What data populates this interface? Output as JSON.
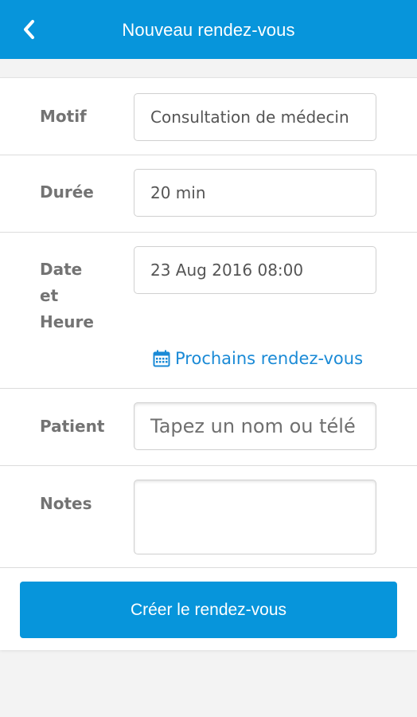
{
  "header": {
    "title": "Nouveau rendez-vous",
    "back_icon": "chevron-left-icon"
  },
  "form": {
    "motif": {
      "label": "Motif",
      "value": "Consultation de médecin"
    },
    "duree": {
      "label": "Durée",
      "value": "20 min"
    },
    "datetime": {
      "label_lines": [
        "Date",
        "et",
        "Heure"
      ],
      "value": "23 Aug 2016 08:00",
      "link_label": "Prochains rendez-vous",
      "link_icon": "calendar-icon"
    },
    "patient": {
      "label": "Patient",
      "placeholder": "Tapez un nom ou télé"
    },
    "notes": {
      "label": "Notes",
      "value": ""
    }
  },
  "submit_label": "Créer le rendez-vous",
  "colors": {
    "primary": "#0795db",
    "link": "#1a8ad6",
    "label": "#737373",
    "background": "#f3f3f3"
  }
}
